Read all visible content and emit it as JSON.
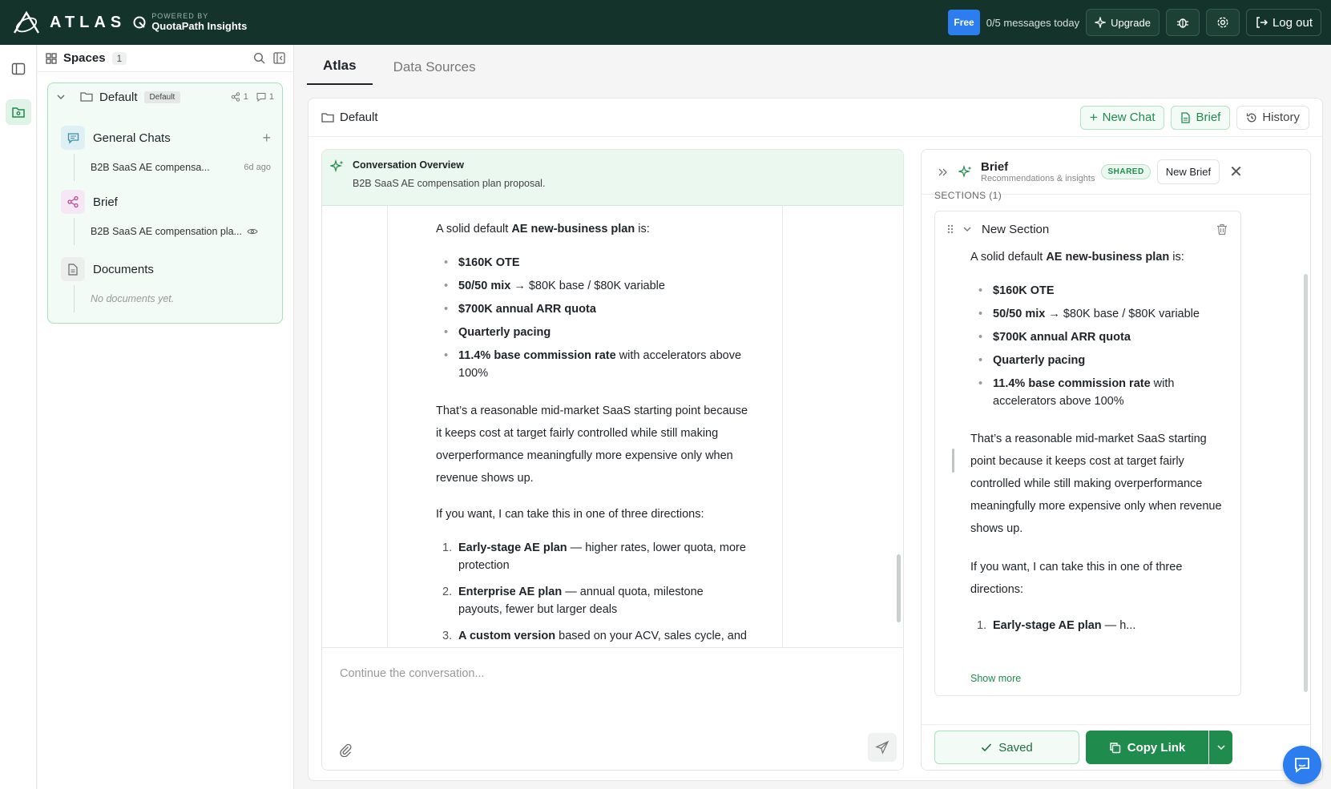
{
  "topbar": {
    "logo_text": "ATLAS",
    "powered_by": "POWERED BY",
    "brand": "QuotaPath Insights",
    "plan_badge": "Free",
    "message_count": "0/5 messages today",
    "upgrade_label": "Upgrade",
    "logout_label": "Log out"
  },
  "spaces": {
    "title": "Spaces",
    "count": "1",
    "space_name": "Default",
    "space_tag": "Default",
    "share_count": "1",
    "chat_count": "1",
    "groups": {
      "general": {
        "label": "General Chats",
        "item": "B2B SaaS AE compensa...",
        "item_age": "6d ago"
      },
      "brief": {
        "label": "Brief",
        "item": "B2B SaaS AE compensation pla..."
      },
      "documents": {
        "label": "Documents",
        "empty": "No documents yet."
      }
    }
  },
  "tabs": [
    "Atlas",
    "Data Sources"
  ],
  "panel": {
    "title": "Default",
    "new_chat": "New Chat",
    "brief": "Brief",
    "history": "History"
  },
  "overview": {
    "title": "Conversation Overview",
    "text": "B2B SaaS AE compensation plan proposal."
  },
  "message": {
    "intro_pre": "A solid default ",
    "intro_bold": "AE new-business plan",
    "intro_post": " is:",
    "bullets": [
      {
        "bold": "$160K OTE",
        "rest": ""
      },
      {
        "bold": "50/50 mix",
        "rest": " → $80K base / $80K variable"
      },
      {
        "bold": "$700K annual ARR quota",
        "rest": ""
      },
      {
        "bold": "Quarterly pacing",
        "rest": ""
      },
      {
        "bold": "11.4% base commission rate",
        "rest": " with accelerators above 100%"
      }
    ],
    "reason": "That’s a reasonable mid-market SaaS starting point because it keeps cost at target fairly controlled while still making overperformance meaningfully more expensive only when revenue shows up.",
    "directions_intro": "If you want, I can take this in one of three directions:",
    "directions": [
      {
        "n": "1.",
        "bold": "Early-stage AE plan",
        "rest": " — higher rates, lower quota, more protection"
      },
      {
        "n": "2.",
        "bold": "Enterprise AE plan",
        "rest": " — annual quota, milestone payouts, fewer but larger deals"
      },
      {
        "n": "3.",
        "bold": "A custom version",
        "rest": " based on your ACV, sales cycle, and target OTE"
      }
    ]
  },
  "composer": {
    "placeholder": "Continue the conversation..."
  },
  "brief_panel": {
    "title": "Brief",
    "subtitle": "Recommendations & insights",
    "shared": "SHARED",
    "new_brief": "New Brief",
    "sections_label": "SECTIONS (1)",
    "section_name": "New Section",
    "truncated_bold": "Early-stage AE plan",
    "truncated_rest": " — h...",
    "show_more": "Show more",
    "saved": "Saved",
    "copy_link": "Copy Link"
  },
  "colors": {
    "topbar": "#14342b",
    "accent": "#1f8b4c",
    "badge": "#2b7df0"
  }
}
